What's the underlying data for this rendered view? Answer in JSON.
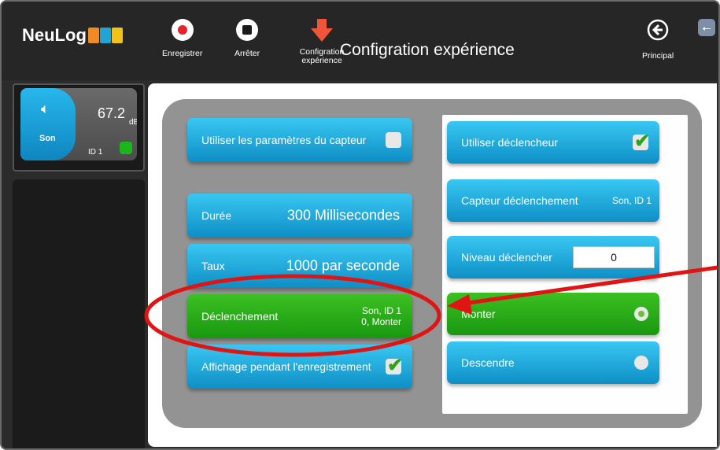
{
  "app": {
    "logo": "NeuLog",
    "title": "Configration expérience"
  },
  "toolbar": {
    "record_label": "Enregistrer",
    "stop_label": "Arrêter",
    "config_label_line1": "Configration",
    "config_label_line2": "expérience",
    "main_label": "Principal",
    "usb_icon": "usb-icon"
  },
  "sensor": {
    "name": "Son",
    "value": "67.2",
    "unit": "dB",
    "id": "ID 1",
    "status_color": "#1bb51e"
  },
  "left_col": {
    "use_sensor_params": "Utiliser les paramètres du capteur",
    "duration_label": "Durée",
    "duration_value": "300 Millisecondes",
    "rate_label": "Taux",
    "rate_value": "1000 par seconde",
    "trigger_label": "Déclenchement",
    "trigger_value_line1": "Son, ID 1",
    "trigger_value_line2": "0, Monter",
    "display_label": "Affichage pendant l'enregistrement"
  },
  "right_col": {
    "use_trigger_label": "Utiliser déclencheur",
    "trigger_sensor_label": "Capteur déclenchement",
    "trigger_sensor_value": "Son, ID 1",
    "trigger_level_label": "Niveau déclencher",
    "trigger_level_value": "0",
    "rise_label": "Monter",
    "fall_label": "Descendre"
  },
  "colors": {
    "accent_blue": "#1aa9dc",
    "accent_green": "#28ab16",
    "annotation_red": "#e11414"
  }
}
